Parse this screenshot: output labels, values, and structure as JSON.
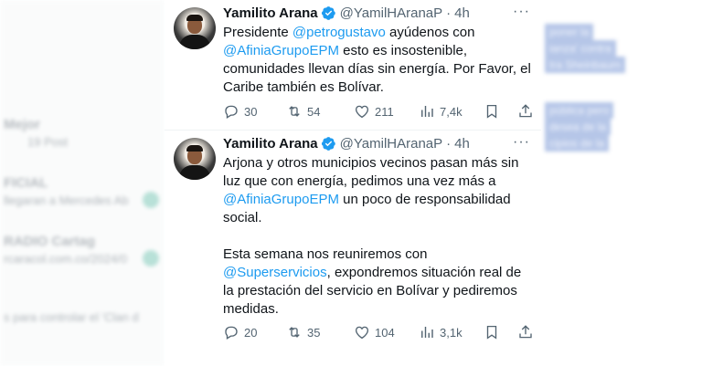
{
  "background_left": {
    "items": [
      {
        "text": "Mejor"
      },
      {
        "text": "19 Post"
      },
      {
        "text": "FICIAL"
      },
      {
        "text": "llegaran a Mercedes Ab"
      },
      {
        "text": "RADIO Cartag"
      },
      {
        "text": "rcaracol.com.co/2024/0"
      },
      {
        "text": "s para controlar el 'Clan d"
      }
    ]
  },
  "background_right": {
    "items": [
      {
        "text": "poner la"
      },
      {
        "text": "ianza' contra"
      },
      {
        "text": "tra Sheinbaum"
      },
      {
        "text": "pública pero"
      },
      {
        "text": "desea de la"
      },
      {
        "text": "cipios de la"
      }
    ]
  },
  "tweets": [
    {
      "name": "Yamilito Arana",
      "handle": "@YamilHAranaP",
      "separator": "·",
      "time": "4h",
      "lines": [
        [
          {
            "t": "Presidente "
          },
          {
            "t": "@petrogustavo",
            "m": true
          },
          {
            "t": " ayúdenos con"
          }
        ],
        [
          {
            "t": "@AfiniaGrupoEPM",
            "m": true
          },
          {
            "t": " esto es insostenible,"
          }
        ],
        [
          {
            "t": "comunidades llevan días sin energía. Por Favor, el"
          }
        ],
        [
          {
            "t": "Caribe también es Bolívar."
          }
        ]
      ],
      "replies": "30",
      "reposts": "54",
      "likes": "211",
      "views": "7,4k"
    },
    {
      "name": "Yamilito Arana",
      "handle": "@YamilHAranaP",
      "separator": "·",
      "time": "4h",
      "lines": [
        [
          {
            "t": "Arjona y otros municipios vecinos pasan más sin"
          }
        ],
        [
          {
            "t": "luz que con energía, pedimos una vez más a"
          }
        ],
        [
          {
            "t": "@AfiniaGrupoEPM",
            "m": true
          },
          {
            "t": " un poco de responsabilidad"
          }
        ],
        [
          {
            "t": "social."
          }
        ],
        [],
        [
          {
            "t": "Esta semana nos reuniremos con"
          }
        ],
        [
          {
            "t": "@Superservicios",
            "m": true
          },
          {
            "t": ", expondremos situación real de"
          }
        ],
        [
          {
            "t": "la prestación del servicio en Bolívar y pediremos"
          }
        ],
        [
          {
            "t": "medidas."
          }
        ]
      ],
      "replies": "20",
      "reposts": "35",
      "likes": "104",
      "views": "3,1k"
    }
  ],
  "icons": {
    "verified": "verified-badge-icon",
    "more": "more-options-icon",
    "reply": "reply-icon",
    "repost": "repost-icon",
    "like": "like-icon",
    "views": "views-icon",
    "bookmark": "bookmark-icon",
    "share": "share-icon"
  },
  "colors": {
    "accent": "#1d9bf0",
    "text": "#0f1419",
    "secondary": "#536471"
  }
}
